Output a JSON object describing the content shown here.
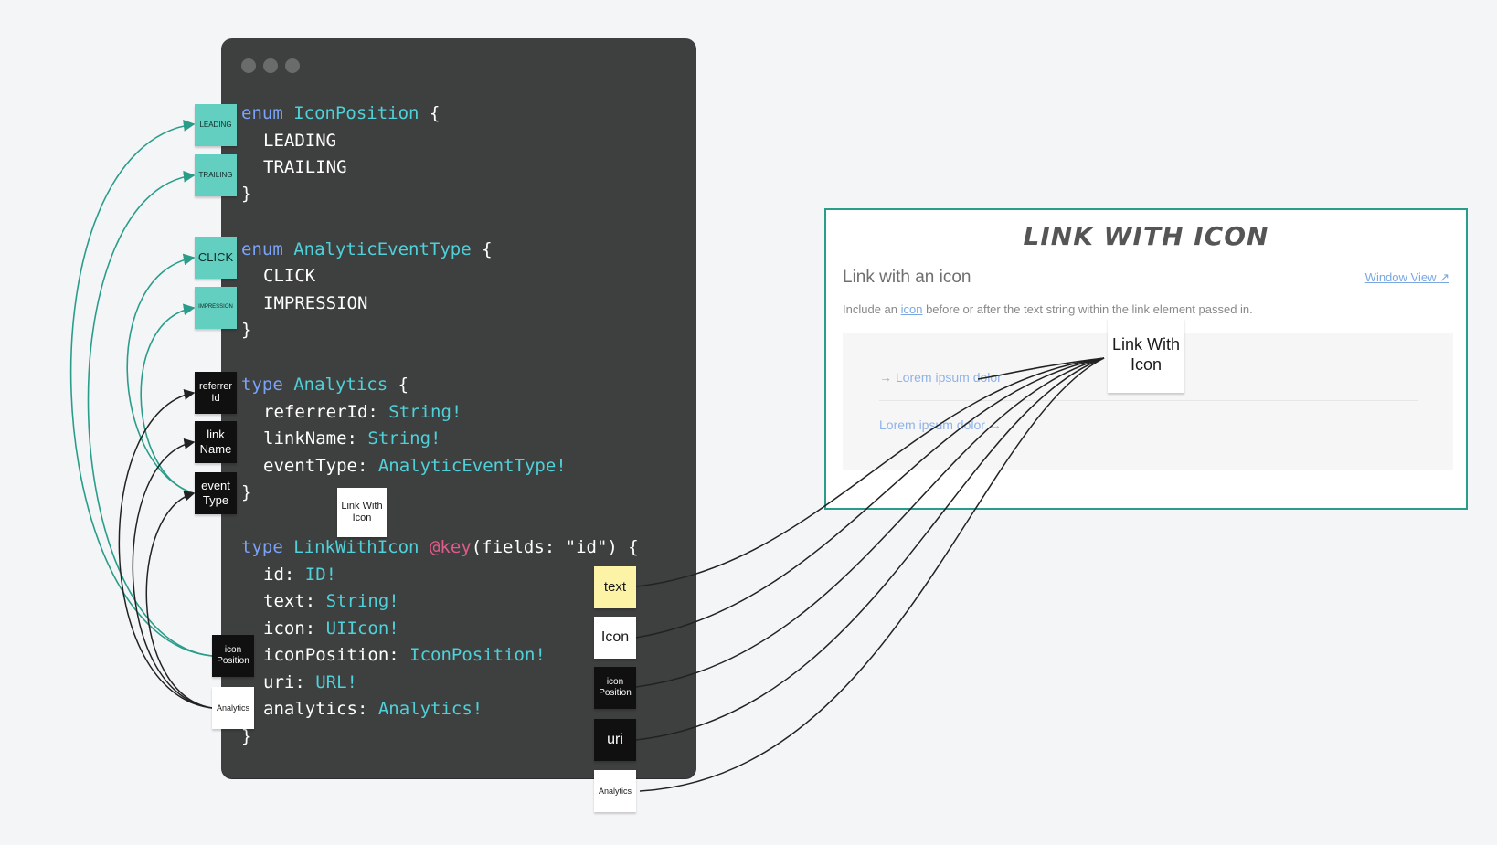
{
  "code": {
    "enum_icon_position": {
      "keyword": "enum",
      "name": "IconPosition",
      "open": "{",
      "values": [
        "LEADING",
        "TRAILING"
      ],
      "close": "}"
    },
    "enum_event_type": {
      "keyword": "enum",
      "name": "AnalyticEventType",
      "open": "{",
      "values": [
        "CLICK",
        "IMPRESSION"
      ],
      "close": "}"
    },
    "type_analytics": {
      "keyword": "type",
      "name": "Analytics",
      "open": "{",
      "fields": [
        {
          "name": "referrerId:",
          "type": "String!"
        },
        {
          "name": "linkName:",
          "type": "String!"
        },
        {
          "name": "eventType:",
          "type": "AnalyticEventType!"
        }
      ],
      "close": "}"
    },
    "type_link": {
      "keyword": "type",
      "name": "LinkWithIcon",
      "directive": "@key",
      "args": "(fields: \"id\") {",
      "fields": [
        {
          "name": "id:",
          "type": "ID!"
        },
        {
          "name": "text:",
          "type": "String!"
        },
        {
          "name": "icon:",
          "type": "UIIcon!"
        },
        {
          "name": "iconPosition:",
          "type": "IconPosition!"
        },
        {
          "name": "uri:",
          "type": "URL!"
        },
        {
          "name": "analytics:",
          "type": "Analytics!"
        }
      ],
      "close": "}"
    }
  },
  "stickies": {
    "leading": "LEADING",
    "trailing": "TRAILING",
    "click": "CLICK",
    "impression": "IMPRESSION",
    "referrer_id": "referrer Id",
    "link_name": "link Name",
    "event_type": "event Type",
    "link_with_icon_small": "Link With Icon",
    "icon_position_left": "icon Position",
    "analytics_left": "Analytics",
    "text": "text",
    "icon": "Icon",
    "icon_position_right": "icon Position",
    "uri": "uri",
    "analytics_right": "Analytics",
    "link_with_icon_big": "Link With Icon"
  },
  "panel": {
    "title": "LINK WITH ICON",
    "heading": "Link with an icon",
    "window_view": "Window View",
    "external_icon": "↗",
    "desc_before": "Include an ",
    "desc_link": "icon",
    "desc_after": " before or after the text string within the link element passed in.",
    "demo_leading_arrow": "→",
    "demo_leading_text": "Lorem ipsum dolor",
    "demo_trailing_text": "Lorem ipsum dolor",
    "demo_trailing_arrow": "→"
  },
  "colors": {
    "editor_bg": "#3e3f3f",
    "keyword": "#7aa2f7",
    "type_name": "#4fd1d9",
    "directive": "#e05a8a",
    "teal_sticky": "#63cfc0",
    "panel_border": "#2a9d8a",
    "wire_teal": "#2a9d8a",
    "wire_black": "#222222"
  }
}
